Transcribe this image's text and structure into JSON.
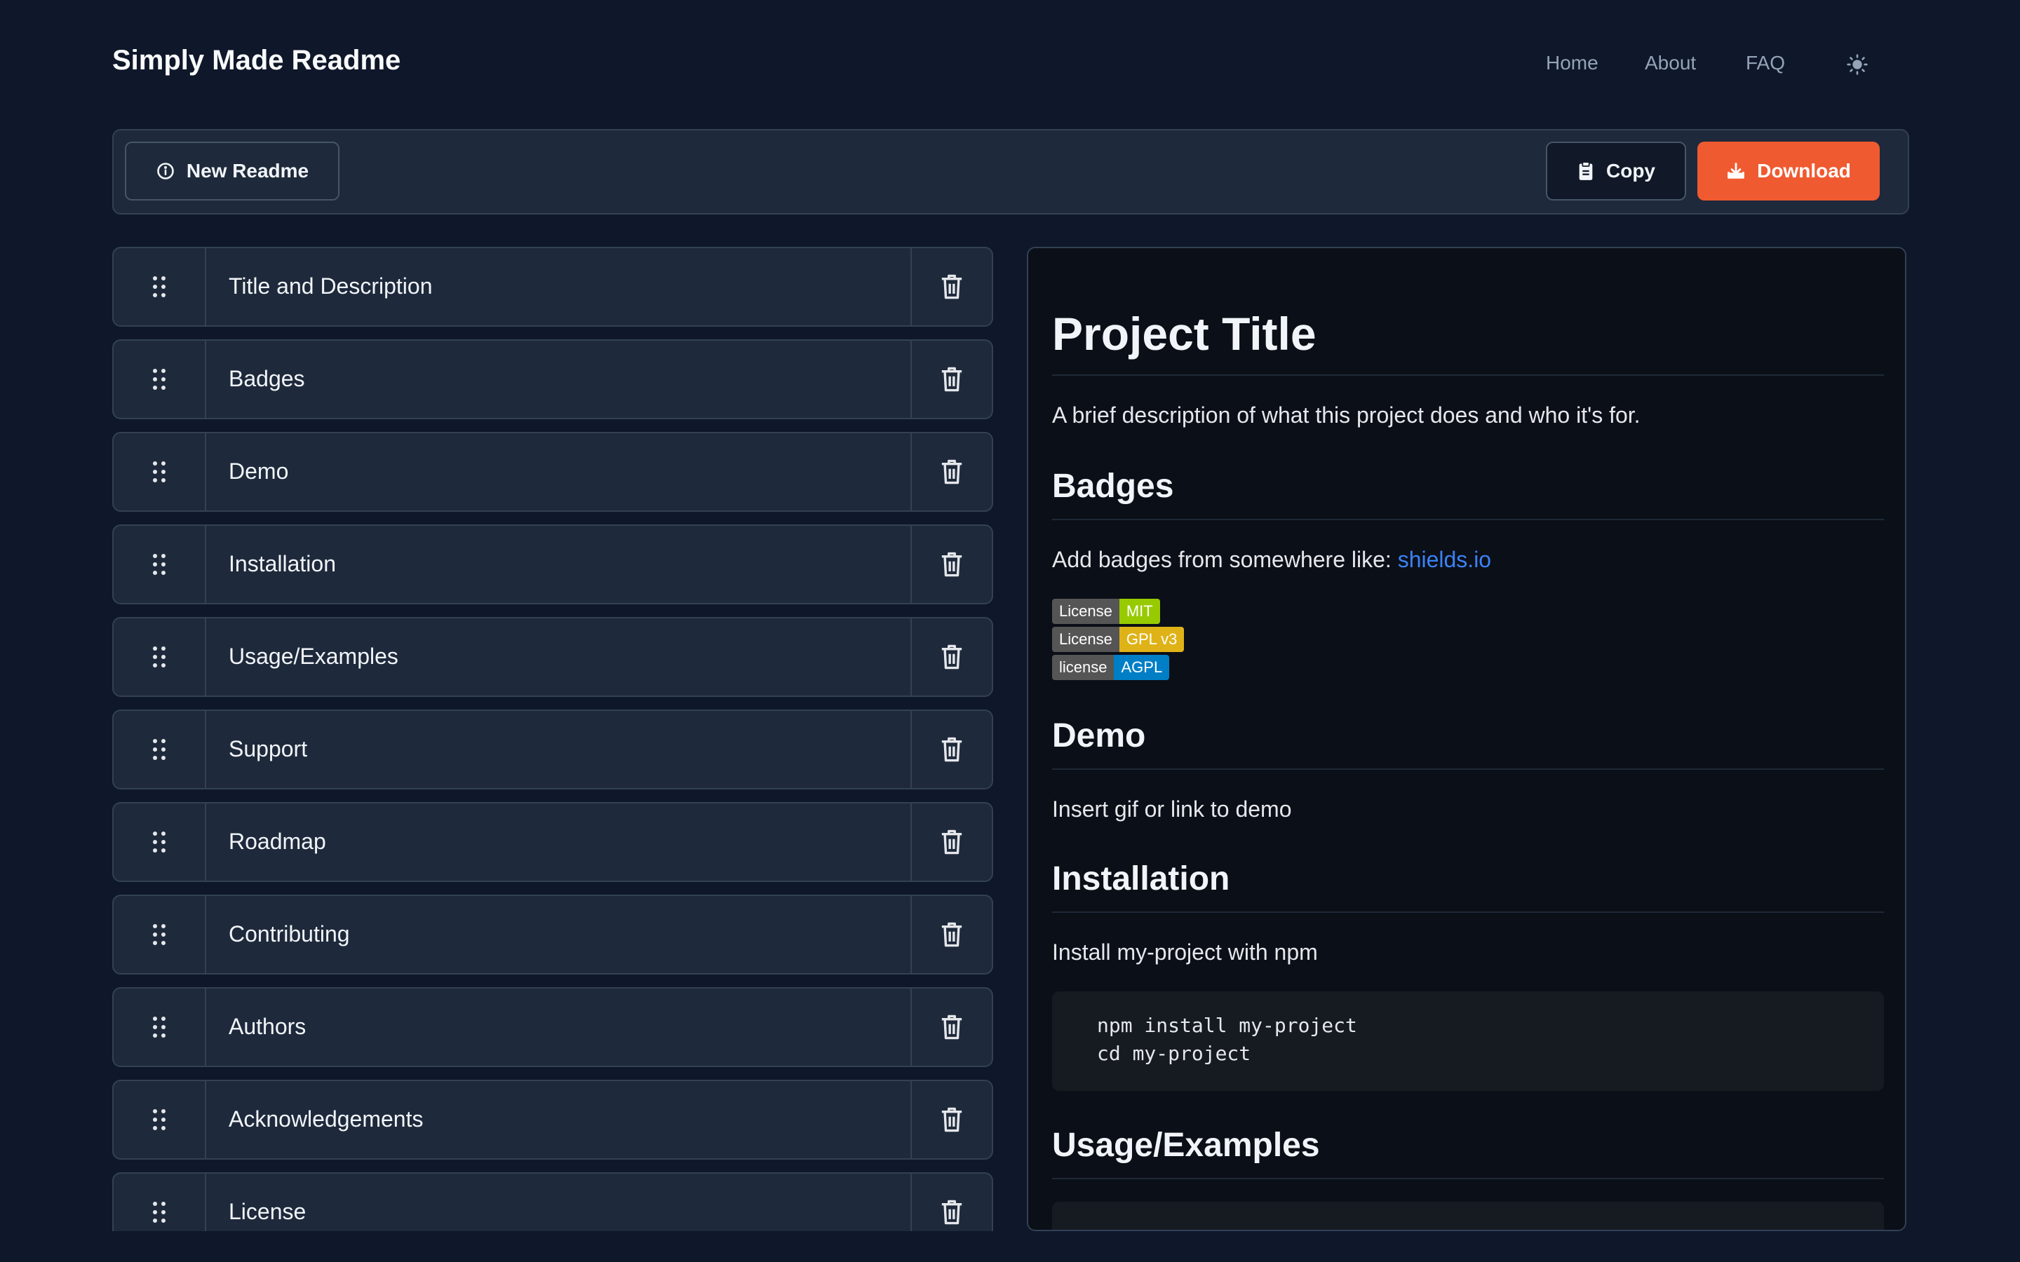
{
  "app": {
    "title": "Simply Made Readme"
  },
  "nav": {
    "home": "Home",
    "about": "About",
    "faq": "FAQ"
  },
  "toolbar": {
    "new_label": "New Readme",
    "copy_label": "Copy",
    "download_label": "Download"
  },
  "sections": [
    "Title and Description",
    "Badges",
    "Demo",
    "Installation",
    "Usage/Examples",
    "Support",
    "Roadmap",
    "Contributing",
    "Authors",
    "Acknowledgements",
    "License"
  ],
  "preview": {
    "title": "Project Title",
    "description": "A brief description of what this project does and who it's for.",
    "badges_heading": "Badges",
    "badges_text": "Add badges from somewhere like: ",
    "badges_link": "shields.io",
    "badges": [
      {
        "label": "License",
        "value": "MIT",
        "color": "#97ca00"
      },
      {
        "label": "License",
        "value": "GPL v3",
        "color": "#dfb317"
      },
      {
        "label": "license",
        "value": "AGPL",
        "color": "#007ec6"
      }
    ],
    "demo_heading": "Demo",
    "demo_text": "Insert gif or link to demo",
    "installation_heading": "Installation",
    "installation_text": "Install my-project with npm",
    "code_line1": "npm install my-project",
    "code_line2": "cd my-project",
    "usage_heading": "Usage/Examples"
  },
  "colors": {
    "background": "#0f172a",
    "accent": "#f05a30",
    "link": "#3b82f6"
  }
}
